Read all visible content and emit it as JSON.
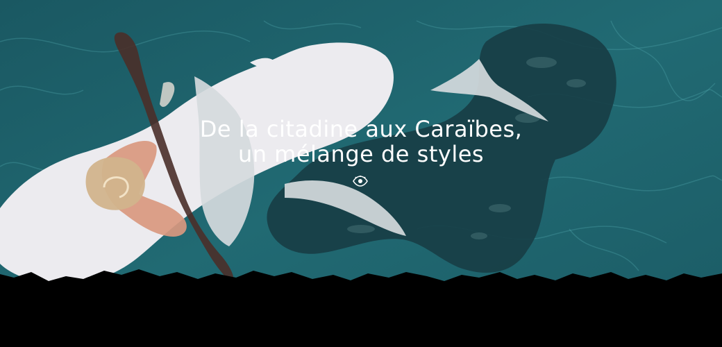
{
  "hero": {
    "title_line_1": "De la citadine aux Caraïbes,",
    "title_line_2": "un mélange de styles",
    "reveal_icon": "eye-icon"
  },
  "colors": {
    "ocean": "#1c5f68",
    "ocean_dark": "#173d45",
    "cloud_white": "#ecebef",
    "cloud_grey": "#d5dadd",
    "bark": "#4a2f29",
    "blush": "#d9987f",
    "sand": "#d2b48c",
    "ground": "#000000",
    "text": "#ffffff"
  }
}
